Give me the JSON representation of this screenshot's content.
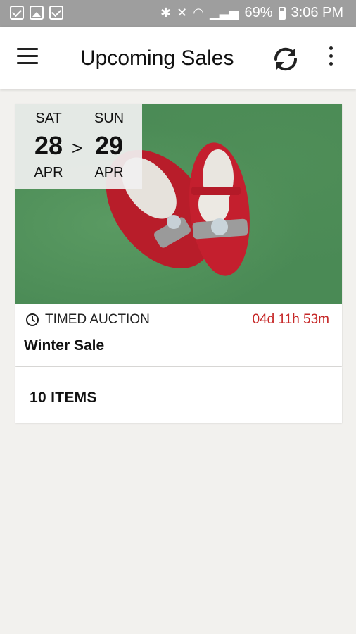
{
  "status_bar": {
    "notifications": [
      "mail-icon",
      "image-icon",
      "mail-icon"
    ],
    "battery": "69%",
    "time": "3:06 PM"
  },
  "app_bar": {
    "title": "Upcoming Sales",
    "menu_icon": "hamburger-menu-icon",
    "refresh_icon": "refresh-icon",
    "more_icon": "more-vertical-icon"
  },
  "sale": {
    "start": {
      "dow": "SAT",
      "day": "28",
      "month": "APR"
    },
    "separator": ">",
    "end": {
      "dow": "SUN",
      "day": "29",
      "month": "APR"
    },
    "type": "TIMED AUCTION",
    "countdown": "04d 11h 53m",
    "name": "Winter Sale",
    "items": "10 ITEMS"
  },
  "colors": {
    "countdown": "#c62828",
    "background": "#f2f1ee",
    "status_bar": "#9e9e9e"
  }
}
